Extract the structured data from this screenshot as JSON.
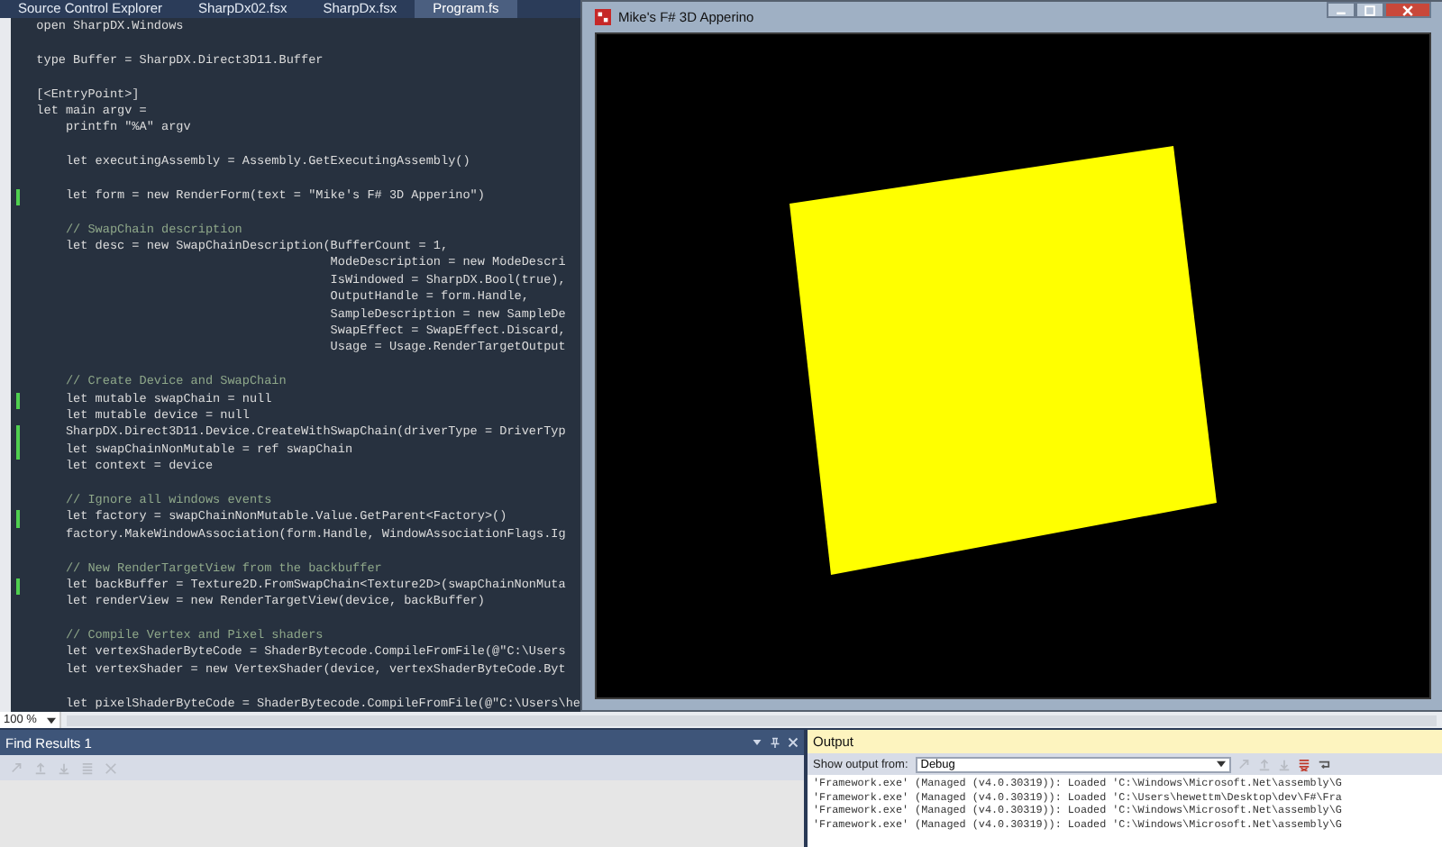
{
  "editor_tabs": [
    {
      "label": "Source Control Explorer",
      "selected": false
    },
    {
      "label": "SharpDx02.fsx",
      "selected": false
    },
    {
      "label": "SharpDx.fsx",
      "selected": false
    },
    {
      "label": "Program.fs",
      "selected": true
    }
  ],
  "code_lines": [
    {
      "kind": "code",
      "text": "open SharpDX.Windows",
      "marked": false
    },
    {
      "kind": "blank",
      "marked": false
    },
    {
      "kind": "code",
      "text": "type Buffer = SharpDX.Direct3D11.Buffer",
      "marked": false
    },
    {
      "kind": "blank",
      "marked": false
    },
    {
      "kind": "code",
      "text": "[<EntryPoint>]",
      "marked": false
    },
    {
      "kind": "code",
      "text": "let main argv =",
      "marked": false
    },
    {
      "kind": "code",
      "text": "    printfn \"%A\" argv",
      "marked": false
    },
    {
      "kind": "blank",
      "marked": false
    },
    {
      "kind": "code",
      "text": "    let executingAssembly = Assembly.GetExecutingAssembly()",
      "marked": false
    },
    {
      "kind": "blank",
      "marked": false
    },
    {
      "kind": "code",
      "text": "    let form = new RenderForm(text = \"Mike's F# 3D Apperino\")",
      "marked": true
    },
    {
      "kind": "blank",
      "marked": false
    },
    {
      "kind": "comment",
      "text": "    // SwapChain description",
      "marked": false
    },
    {
      "kind": "code",
      "text": "    let desc = new SwapChainDescription(BufferCount = 1,",
      "marked": false
    },
    {
      "kind": "code",
      "text": "                                        ModeDescription = new ModeDescri",
      "marked": false
    },
    {
      "kind": "code",
      "text": "                                        IsWindowed = SharpDX.Bool(true),",
      "marked": false
    },
    {
      "kind": "code",
      "text": "                                        OutputHandle = form.Handle,",
      "marked": false
    },
    {
      "kind": "code",
      "text": "                                        SampleDescription = new SampleDe",
      "marked": false
    },
    {
      "kind": "code",
      "text": "                                        SwapEffect = SwapEffect.Discard,",
      "marked": false
    },
    {
      "kind": "code",
      "text": "                                        Usage = Usage.RenderTargetOutput",
      "marked": false
    },
    {
      "kind": "blank",
      "marked": false
    },
    {
      "kind": "comment",
      "text": "    // Create Device and SwapChain",
      "marked": false
    },
    {
      "kind": "code",
      "text": "    let mutable swapChain = null",
      "marked": true
    },
    {
      "kind": "code",
      "text": "    let mutable device = null",
      "marked": false
    },
    {
      "kind": "code",
      "text": "    SharpDX.Direct3D11.Device.CreateWithSwapChain(driverType = DriverTyp",
      "marked": true
    },
    {
      "kind": "code",
      "text": "    let swapChainNonMutable = ref swapChain",
      "marked": true
    },
    {
      "kind": "code",
      "text": "    let context = device",
      "marked": false
    },
    {
      "kind": "blank",
      "marked": false
    },
    {
      "kind": "comment",
      "text": "    // Ignore all windows events",
      "marked": false
    },
    {
      "kind": "code",
      "text": "    let factory = swapChainNonMutable.Value.GetParent<Factory>()",
      "marked": true
    },
    {
      "kind": "code",
      "text": "    factory.MakeWindowAssociation(form.Handle, WindowAssociationFlags.Ig",
      "marked": false
    },
    {
      "kind": "blank",
      "marked": false
    },
    {
      "kind": "comment",
      "text": "    // New RenderTargetView from the backbuffer",
      "marked": false
    },
    {
      "kind": "code",
      "text": "    let backBuffer = Texture2D.FromSwapChain<Texture2D>(swapChainNonMuta",
      "marked": true
    },
    {
      "kind": "code",
      "text": "    let renderView = new RenderTargetView(device, backBuffer)",
      "marked": false
    },
    {
      "kind": "blank",
      "marked": false
    },
    {
      "kind": "comment",
      "text": "    // Compile Vertex and Pixel shaders",
      "marked": false
    },
    {
      "kind": "code",
      "text": "    let vertexShaderByteCode = ShaderBytecode.CompileFromFile(@\"C:\\Users",
      "marked": false
    },
    {
      "kind": "code",
      "text": "    let vertexShader = new VertexShader(device, vertexShaderByteCode.Byt",
      "marked": false
    },
    {
      "kind": "blank",
      "marked": false
    },
    {
      "kind": "code",
      "text": "    let pixelShaderByteCode = ShaderBytecode.CompileFromFile(@\"C:\\Users\\he",
      "marked": false
    }
  ],
  "app_window": {
    "title": "Mike's F# 3D Apperino"
  },
  "zoom_level": "100 %",
  "find_results": {
    "title": "Find Results 1"
  },
  "output": {
    "title": "Output",
    "source_label": "Show output from:",
    "source_value": "Debug",
    "lines": [
      "'Framework.exe' (Managed (v4.0.30319)): Loaded 'C:\\Windows\\Microsoft.Net\\assembly\\G",
      "'Framework.exe' (Managed (v4.0.30319)): Loaded 'C:\\Users\\hewettm\\Desktop\\dev\\F#\\Fra",
      "'Framework.exe' (Managed (v4.0.30319)): Loaded 'C:\\Windows\\Microsoft.Net\\assembly\\G",
      "'Framework.exe' (Managed (v4.0.30319)): Loaded 'C:\\Windows\\Microsoft.Net\\assembly\\G"
    ]
  }
}
